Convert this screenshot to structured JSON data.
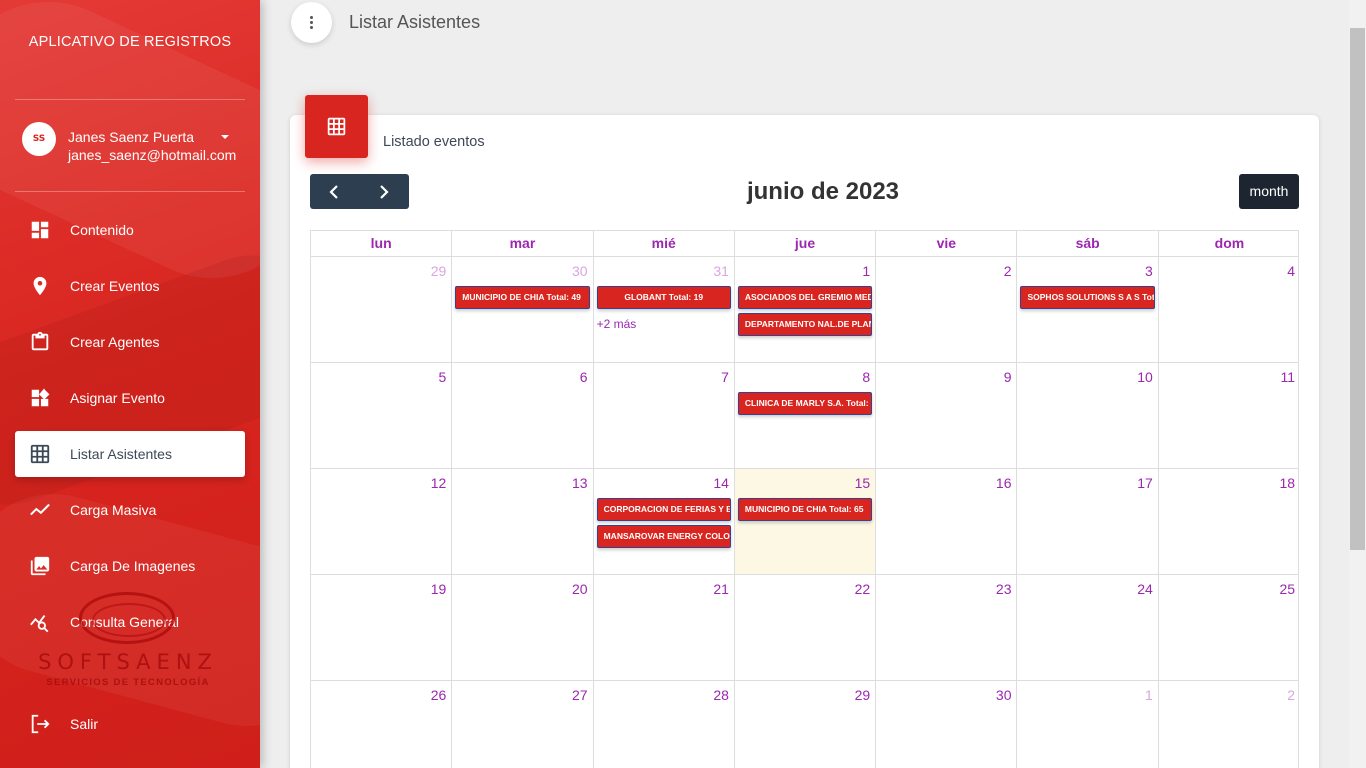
{
  "app": {
    "brand": "APLICATIVO DE REGISTROS"
  },
  "user": {
    "name": "Janes Saenz Puerta",
    "email": "janes_saenz@hotmail.com",
    "avatar_text": "SS"
  },
  "nav": {
    "items": [
      {
        "label": "Contenido",
        "icon": "dashboard-icon"
      },
      {
        "label": "Crear Eventos",
        "icon": "location-pin-icon"
      },
      {
        "label": "Crear Agentes",
        "icon": "clipboard-icon"
      },
      {
        "label": "Asignar Evento",
        "icon": "widgets-icon"
      },
      {
        "label": "Listar Asistentes",
        "icon": "grid-icon",
        "active": true
      },
      {
        "label": "Carga Masiva",
        "icon": "timeline-icon"
      },
      {
        "label": "Carga De Imagenes",
        "icon": "photo-library-icon"
      },
      {
        "label": "Consulta General",
        "icon": "query-stats-icon"
      },
      {
        "label": "Salir",
        "icon": "logout-icon"
      }
    ]
  },
  "logo": {
    "word": "SOFTSAENZ",
    "tagline": "SERVICIOS DE TECNOLOGÍA"
  },
  "header": {
    "title": "Listar Asistentes"
  },
  "card": {
    "title": "Listado eventos"
  },
  "calendar": {
    "title": "junio de 2023",
    "view_button": "month",
    "weekdays": [
      "lun",
      "mar",
      "mié",
      "jue",
      "vie",
      "sáb",
      "dom"
    ],
    "more_label": "+2 más",
    "weeks": [
      [
        {
          "n": "29",
          "other": true
        },
        {
          "n": "30",
          "other": true,
          "events": [
            "MUNICIPIO DE CHIA Total: 49"
          ]
        },
        {
          "n": "31",
          "other": true,
          "events": [
            "GLOBANT Total: 19"
          ],
          "more": true
        },
        {
          "n": "1",
          "events": [
            "ASOCIADOS DEL GREMIO MEDICO",
            "DEPARTAMENTO NAL.DE PLANEACION"
          ]
        },
        {
          "n": "2"
        },
        {
          "n": "3",
          "events": [
            "SOPHOS SOLUTIONS S A S Total"
          ]
        },
        {
          "n": "4"
        }
      ],
      [
        {
          "n": "5"
        },
        {
          "n": "6"
        },
        {
          "n": "7"
        },
        {
          "n": "8",
          "events": [
            "CLINICA DE MARLY S.A. Total:"
          ]
        },
        {
          "n": "9"
        },
        {
          "n": "10"
        },
        {
          "n": "11"
        }
      ],
      [
        {
          "n": "12"
        },
        {
          "n": "13"
        },
        {
          "n": "14",
          "events": [
            "CORPORACION DE FERIAS Y EXPOSICIONES",
            "MANSAROVAR ENERGY COLOMBIA"
          ]
        },
        {
          "n": "15",
          "today": true,
          "events": [
            "MUNICIPIO DE CHIA Total: 65"
          ]
        },
        {
          "n": "16"
        },
        {
          "n": "17"
        },
        {
          "n": "18"
        }
      ],
      [
        {
          "n": "19"
        },
        {
          "n": "20"
        },
        {
          "n": "21"
        },
        {
          "n": "22"
        },
        {
          "n": "23"
        },
        {
          "n": "24"
        },
        {
          "n": "25"
        }
      ],
      [
        {
          "n": "26"
        },
        {
          "n": "27"
        },
        {
          "n": "28"
        },
        {
          "n": "29"
        },
        {
          "n": "30"
        },
        {
          "n": "1",
          "other": true
        },
        {
          "n": "2",
          "other": true
        }
      ]
    ]
  },
  "colors": {
    "brand_red": "#d9251f",
    "accent_purple": "#9c27b0",
    "today_bg": "#fcf8e3",
    "dark_button": "#2c3e50"
  }
}
